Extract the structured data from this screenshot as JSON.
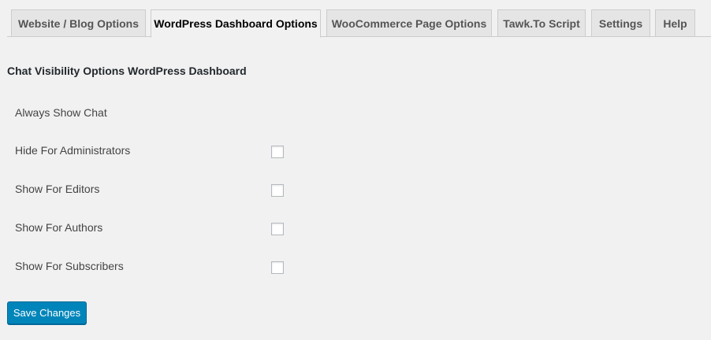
{
  "tabs": [
    {
      "label": "Website / Blog Options"
    },
    {
      "label": "WordPress Dashboard Options"
    },
    {
      "label": "WooCommerce Page Options"
    },
    {
      "label": "Tawk.To Script"
    },
    {
      "label": "Settings"
    },
    {
      "label": "Help"
    }
  ],
  "active_tab": "WordPress Dashboard Options",
  "section": {
    "title": "Chat Visibility Options WordPress Dashboard"
  },
  "options": [
    {
      "label": "Always Show Chat"
    },
    {
      "label": "Hide For Administrators",
      "checked": false
    },
    {
      "label": "Show For Editors",
      "checked": false
    },
    {
      "label": "Show For Authors",
      "checked": false
    },
    {
      "label": "Show For Subscribers",
      "checked": false
    }
  ],
  "save_button": {
    "label": "Save Changes"
  },
  "colors": {
    "button_primary": "#0085ba",
    "page_background": "#f1f1f1"
  }
}
